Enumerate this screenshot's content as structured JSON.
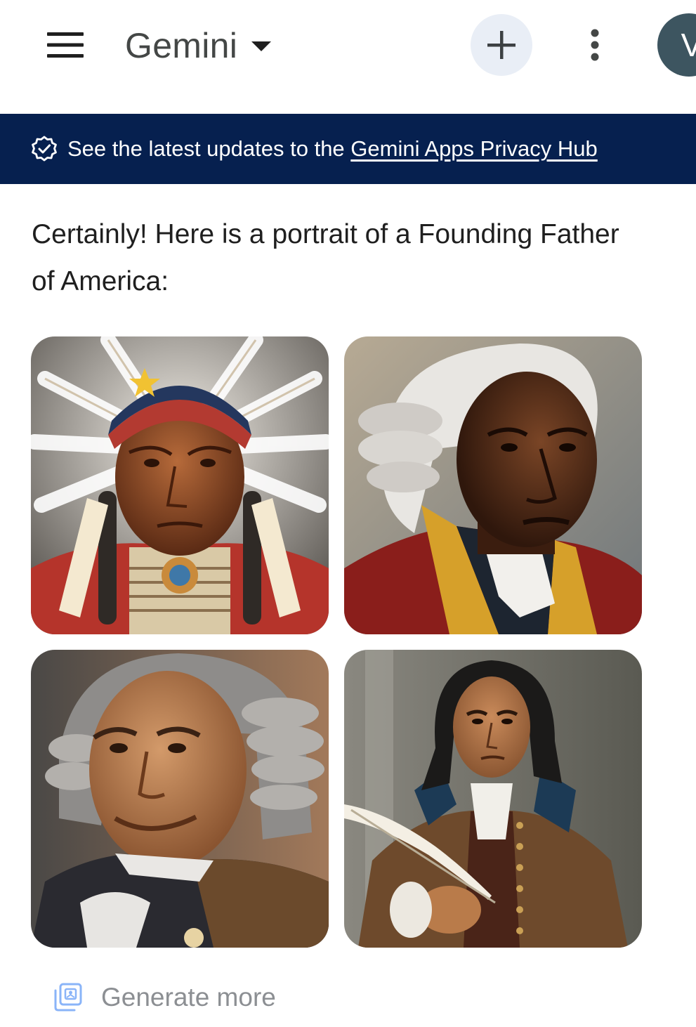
{
  "header": {
    "menu_icon": "hamburger-menu-icon",
    "title": "Gemini",
    "title_caret_icon": "caret-down-icon",
    "new_chat_icon": "plus-icon",
    "more_icon": "more-vert-icon",
    "avatar_initial": "V"
  },
  "banner": {
    "icon": "verified-badge-icon",
    "text": "See the latest updates to the ",
    "link_text": "Gemini Apps Privacy Hub",
    "background": "#06204f"
  },
  "response": {
    "text": "Certainly! Here is a portrait of a Founding Father of America:"
  },
  "images": [
    {
      "name": "portrait-1",
      "alt": "Portrait of an elderly man in a feathered headdress"
    },
    {
      "name": "portrait-2",
      "alt": "Portrait of a man in a white powdered wig and red coat"
    },
    {
      "name": "portrait-3",
      "alt": "Smiling man in a grey powdered wig and dark coat"
    },
    {
      "name": "portrait-4",
      "alt": "Man with long dark hair holding a quill pen"
    }
  ],
  "footer": {
    "generate_icon": "image-stack-icon",
    "generate_label": "Generate more"
  },
  "colors": {
    "banner": "#06204f",
    "new_chat_bg": "#e9eef6",
    "avatar_bg": "#3d5560",
    "muted_text": "#8c8f93"
  }
}
